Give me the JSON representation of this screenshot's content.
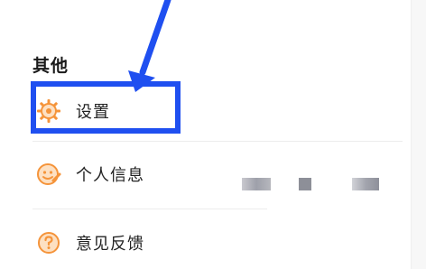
{
  "section": {
    "title": "其他"
  },
  "menu": {
    "items": [
      {
        "label": "设置",
        "icon": "gear-icon"
      },
      {
        "label": "个人信息",
        "icon": "face-edit-icon"
      },
      {
        "label": "意见反馈",
        "icon": "question-icon"
      }
    ]
  },
  "colors": {
    "accent_orange": "#f5943a",
    "annotation_blue": "#1f4ff0",
    "text": "#222222"
  }
}
